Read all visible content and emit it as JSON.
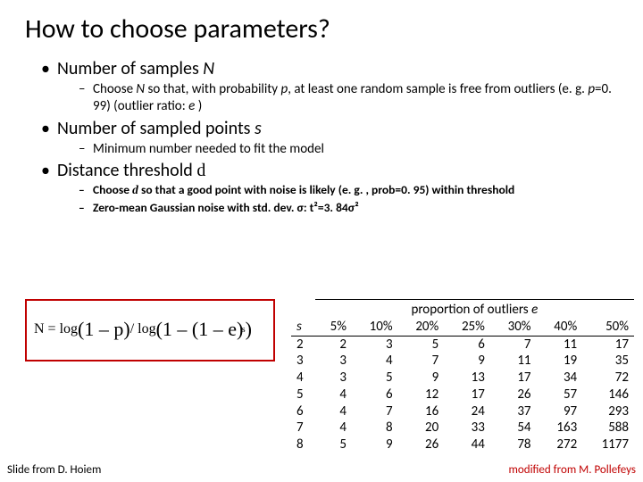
{
  "title": "How to choose parameters?",
  "b1": {
    "label": "Number of samples ",
    "var": "N"
  },
  "b1s": {
    "pre": "Choose ",
    "N": "N",
    "mid1": " so that, with probability ",
    "p": "p",
    "mid2": ", at least one random sample is free from outliers (e. g. ",
    "pval": "p",
    "eq": "=0. 99) (outlier ratio: ",
    "e": "e",
    "end": " )"
  },
  "b2": {
    "label": "Number of sampled points ",
    "var": "s"
  },
  "b2s": "Minimum number needed to fit the model",
  "b3": {
    "label": "Distance threshold ",
    "delta": "d"
  },
  "b3s1": {
    "pre": "Choose ",
    "d": "d",
    "post": " so that a good point with noise is likely (e. g. , prob=0. 95) within threshold"
  },
  "b3s2": "Zero-mean Gaussian noise with std. dev. σ: t²=3. 84σ²",
  "formula": {
    "lhs": "N = log",
    "p1": "(1 – p)",
    "div": "/ log",
    "p2": "(1 – (1 – e)",
    "sup": "s",
    "close": ")"
  },
  "table": {
    "caption_pre": "proportion of outliers ",
    "caption_var": "e",
    "header": [
      "s",
      "5%",
      "10%",
      "20%",
      "25%",
      "30%",
      "40%",
      "50%"
    ],
    "rows": [
      [
        "2",
        "2",
        "3",
        "5",
        "6",
        "7",
        "11",
        "17"
      ],
      [
        "3",
        "3",
        "4",
        "7",
        "9",
        "11",
        "19",
        "35"
      ],
      [
        "4",
        "3",
        "5",
        "9",
        "13",
        "17",
        "34",
        "72"
      ],
      [
        "5",
        "4",
        "6",
        "12",
        "17",
        "26",
        "57",
        "146"
      ],
      [
        "6",
        "4",
        "7",
        "16",
        "24",
        "37",
        "97",
        "293"
      ],
      [
        "7",
        "4",
        "8",
        "20",
        "33",
        "54",
        "163",
        "588"
      ],
      [
        "8",
        "5",
        "9",
        "26",
        "44",
        "78",
        "272",
        "1177"
      ]
    ]
  },
  "footer_left": "Slide from D. Hoiem",
  "footer_right": "modified from  M. Pollefeys"
}
